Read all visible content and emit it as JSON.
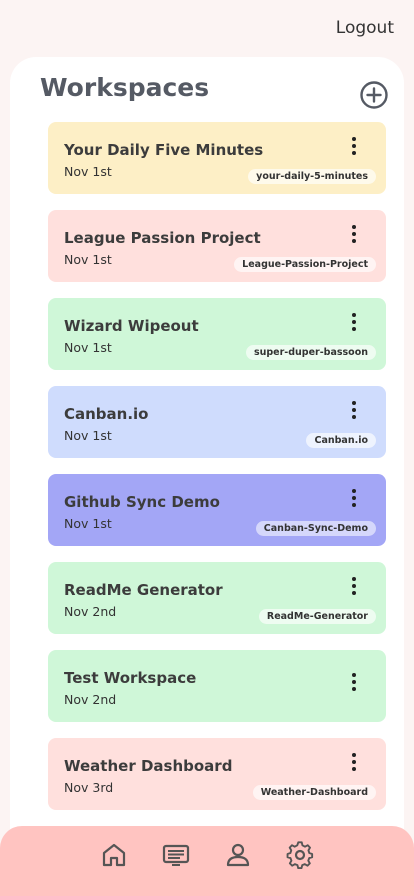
{
  "header": {
    "logout_label": "Logout"
  },
  "main": {
    "title": "Workspaces",
    "workspaces": [
      {
        "title": "Your Daily Five Minutes",
        "date": "Nov 1st",
        "badge": "your-daily-5-minutes",
        "color": "#fdefc6"
      },
      {
        "title": "League Passion Project",
        "date": "Nov 1st",
        "badge": "League-Passion-Project",
        "color": "#ffe0dd"
      },
      {
        "title": "Wizard Wipeout",
        "date": "Nov 1st",
        "badge": "super-duper-bassoon",
        "color": "#cff7d8"
      },
      {
        "title": "Canban.io",
        "date": "Nov 1st",
        "badge": "Canban.io",
        "color": "#cfdcfd"
      },
      {
        "title": "Github Sync Demo",
        "date": "Nov 1st",
        "badge": "Canban-Sync-Demo",
        "color": "#a3a6f6"
      },
      {
        "title": "ReadMe Generator",
        "date": "Nov 2nd",
        "badge": "ReadMe-Generator",
        "color": "#cff7d8"
      },
      {
        "title": "Test Workspace",
        "date": "Nov 2nd",
        "badge": "",
        "color": "#cff7d8"
      },
      {
        "title": "Weather Dashboard",
        "date": "Nov 3rd",
        "badge": "Weather-Dashboard",
        "color": "#ffe0dd"
      }
    ]
  },
  "icons": {
    "add": "plus-circle-icon",
    "card_menu": "more-vertical-icon",
    "nav": [
      "home-icon",
      "list-icon",
      "user-icon",
      "settings-icon"
    ]
  },
  "colors": {
    "bottom_bar": "#ffc4c1",
    "page_bg": "#fcf4f3"
  }
}
